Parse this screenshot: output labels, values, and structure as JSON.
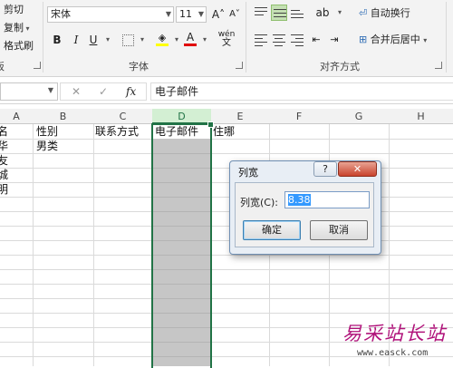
{
  "ribbon": {
    "clipboard": {
      "cut": "剪切",
      "copy": "复制",
      "format_painter": "格式刷",
      "group_label_fragment": "板"
    },
    "font": {
      "name": "宋体",
      "size": "11",
      "grow_icon": "A˄",
      "shrink_icon": "A˅",
      "bold": "B",
      "italic": "I",
      "underline": "U",
      "phonetic": "wén",
      "group_label": "字体"
    },
    "alignment": {
      "wrap_text": "自动换行",
      "merge_center": "合并后居中",
      "group_label": "对齐方式"
    },
    "accent_green": "#217346"
  },
  "formula_bar": {
    "cancel": "✕",
    "enter": "✓",
    "fx": "fx",
    "value": "电子邮件"
  },
  "columns": [
    "A",
    "B",
    "C",
    "D",
    "E",
    "F",
    "G",
    "H"
  ],
  "selected_column": "D",
  "cells": {
    "a1": "名",
    "b1": "性别",
    "c1": "联系方式",
    "d1": "电子邮件",
    "e1": "住哪",
    "a2": "华",
    "b2": "男类",
    "a3": "友",
    "a4": "城",
    "a5": "明"
  },
  "dialog": {
    "title": "列宽",
    "help": "?",
    "close": "✕",
    "label": "列宽(C):",
    "value": "8.38",
    "ok": "确定",
    "cancel": "取消"
  },
  "watermark": {
    "text": "易采站长站",
    "url": "www.easck.com"
  }
}
